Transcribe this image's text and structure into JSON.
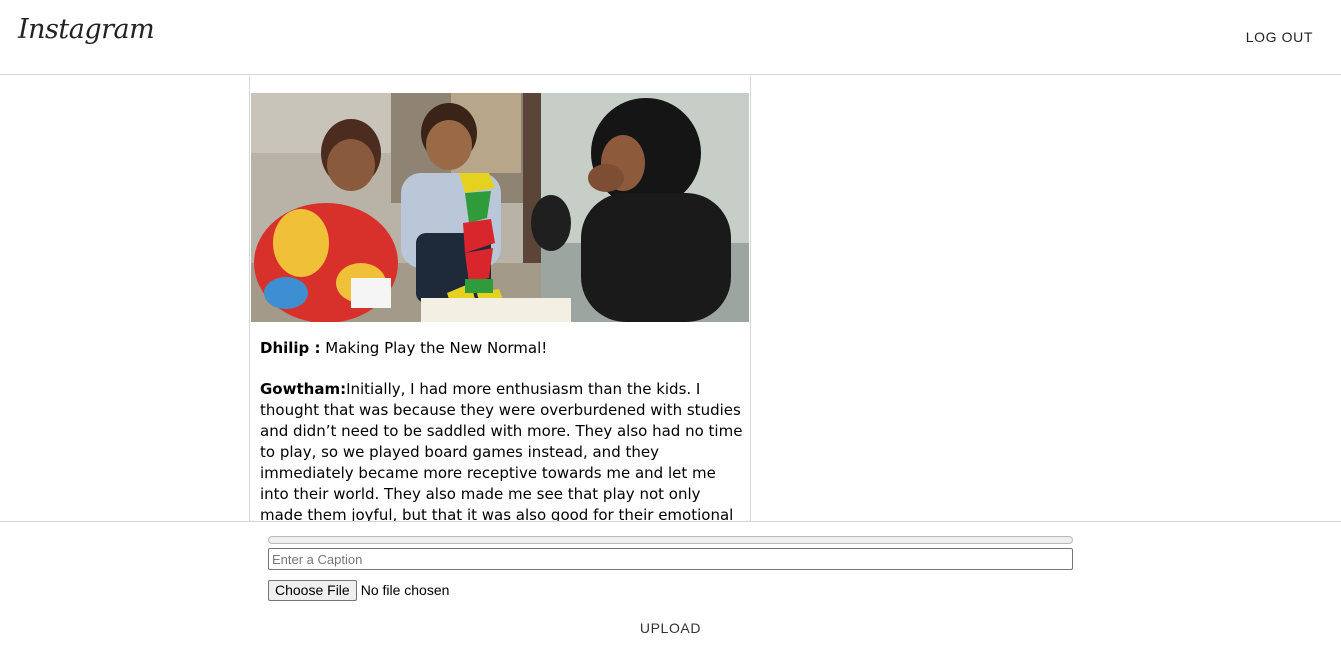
{
  "header": {
    "logo_text": "Instagram",
    "logout_label": "LOG OUT"
  },
  "post": {
    "image_icon": "photo-of-children-playing-with-colorful-blocks",
    "caption": {
      "username": "Dhilip :",
      "text": "Making Play the New Normal!"
    },
    "comment": {
      "username": "Gowtham:",
      "text": "Initially, I had more enthusiasm than the kids. I thought that was because they were overburdened with studies and didn’t need to be saddled with more. They also had no time to play, so we played board games instead, and they immediately became more receptive towards me and let me into their world. They also made me see that play not only made them joyful, but that it was also good for their emotional and mental well-being, their learning and"
    }
  },
  "upload_form": {
    "progress_value": 0,
    "caption_placeholder": "Enter a Caption",
    "caption_value": "",
    "choose_file_label": "Choose File",
    "file_status": "No file chosen",
    "upload_label": "UPLOAD"
  },
  "colors": {
    "border": "#d6d6d6",
    "text": "#222222"
  }
}
